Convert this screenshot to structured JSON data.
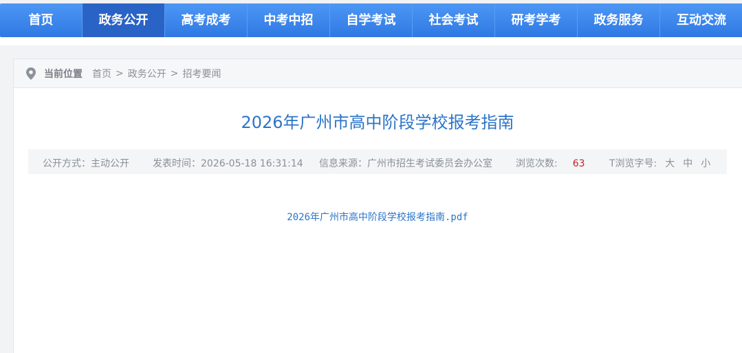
{
  "nav": {
    "items": [
      {
        "label": "首页"
      },
      {
        "label": "政务公开"
      },
      {
        "label": "高考成考"
      },
      {
        "label": "中考中招"
      },
      {
        "label": "自学考试"
      },
      {
        "label": "社会考试"
      },
      {
        "label": "研考学考"
      },
      {
        "label": "政务服务"
      },
      {
        "label": "互动交流"
      }
    ],
    "active_index": 1,
    "color_active": "#2a63c6",
    "color_bar": "#3a84ee"
  },
  "breadcrumb": {
    "icon": "location-pin-icon",
    "label": "当前位置",
    "items": [
      "首页",
      "政务公开",
      "招考要闻"
    ],
    "separator": ">"
  },
  "article": {
    "title": "2026年广州市高中阶段学校报考指南",
    "meta": {
      "disclosure_label": "公开方式：",
      "disclosure_value": "主动公开",
      "published_label": "发表时间：",
      "published_value": "2026-05-18 16:31:14",
      "source_label": "信息来源：",
      "source_value": "广州市招生考试委员会办公室",
      "views_label": "浏览次数:",
      "views_value": "63",
      "fontsize_label": "T浏览字号:",
      "fontsize_options": [
        "大",
        "中",
        "小"
      ]
    },
    "attachment": "2026年广州市高中阶段学校报考指南.pdf"
  },
  "colors": {
    "title_blue": "#2b74c8",
    "views_red": "#c0232a"
  }
}
